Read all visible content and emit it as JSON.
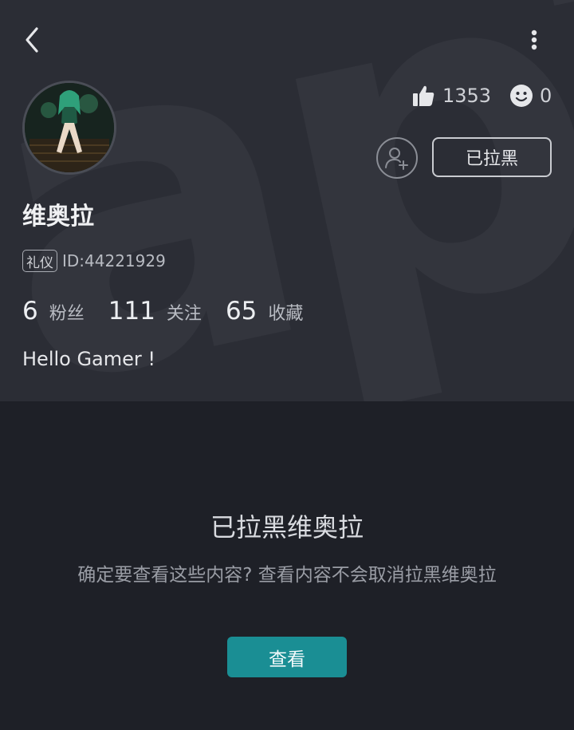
{
  "profile": {
    "name": "维奥拉",
    "tag": "礼仪",
    "uid": "ID:44221929",
    "bio": "Hello Gamer !",
    "likes": "1353",
    "emoji_count": "0",
    "block_status_label": "已拉黑",
    "counts": [
      {
        "value": "6",
        "label": "粉丝"
      },
      {
        "value": "111",
        "label": "关注"
      },
      {
        "value": "65",
        "label": "收藏"
      }
    ]
  },
  "block_notice": {
    "title": "已拉黑维奥拉",
    "description": "确定要查看这些内容? 查看内容不会取消拉黑维奥拉",
    "view_button_label": "查看"
  },
  "icons": {
    "back": "chevron-left-icon",
    "more": "more-vertical-icon",
    "like": "thumbs-up-icon",
    "emoji": "smiley-icon",
    "follow": "add-user-icon"
  },
  "colors": {
    "header_bg": "#2b2d35",
    "page_bg": "#1e2027",
    "accent": "#1a8e94"
  }
}
